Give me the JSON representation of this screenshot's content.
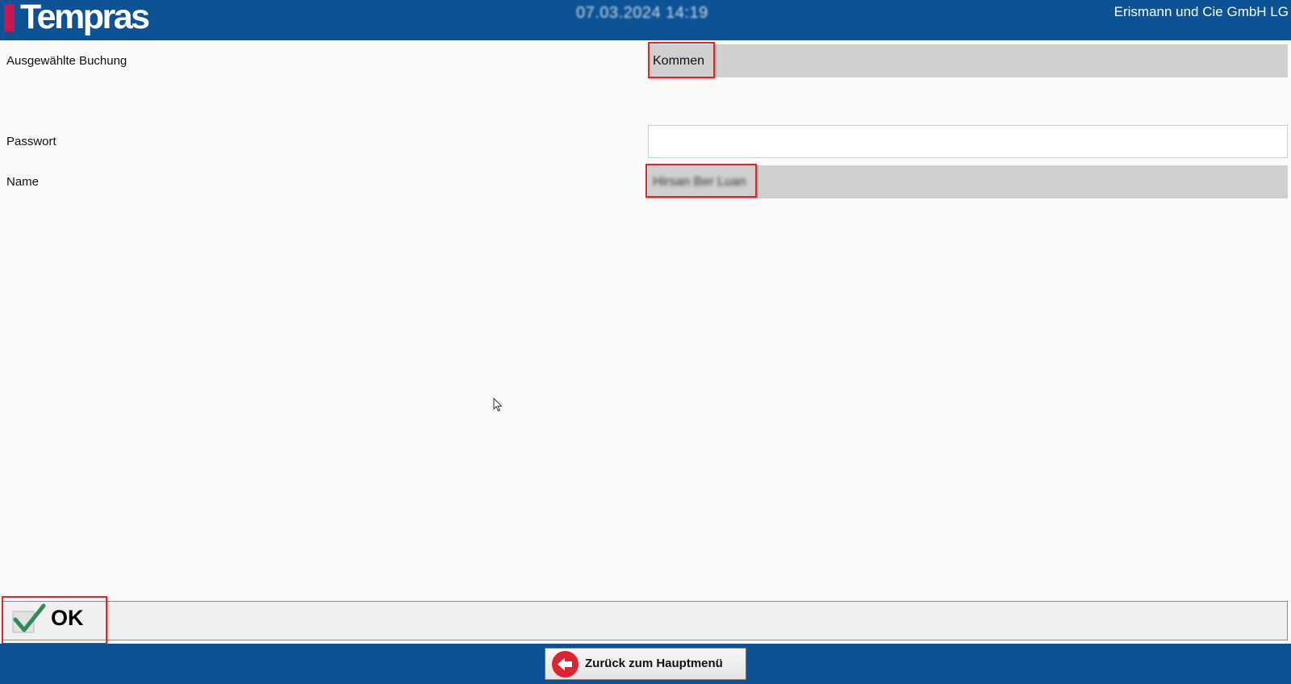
{
  "header": {
    "logo_text": "Tempras",
    "datetime": "07.03.2024 14:19",
    "company": "Erismann und Cie GmbH LG"
  },
  "form": {
    "booking": {
      "label": "Ausgewählte Buchung",
      "value": "Kommen"
    },
    "password": {
      "label": "Passwort",
      "value": "",
      "placeholder": ""
    },
    "name": {
      "label": "Name",
      "value": "Hirsan Ber Luan"
    }
  },
  "actions": {
    "ok_label": "OK",
    "back_label": "Zurück zum Hauptmenü"
  },
  "colors": {
    "header_bg": "#0c5294",
    "logo_accent": "#c8174f",
    "highlight": "#e0262b",
    "readonly_field": "#d0d0d0",
    "ok_check": "#2e8b57",
    "back_icon": "#dd2230"
  },
  "icons": [
    "check-icon",
    "back-arrow-icon",
    "mouse-pointer-icon"
  ]
}
